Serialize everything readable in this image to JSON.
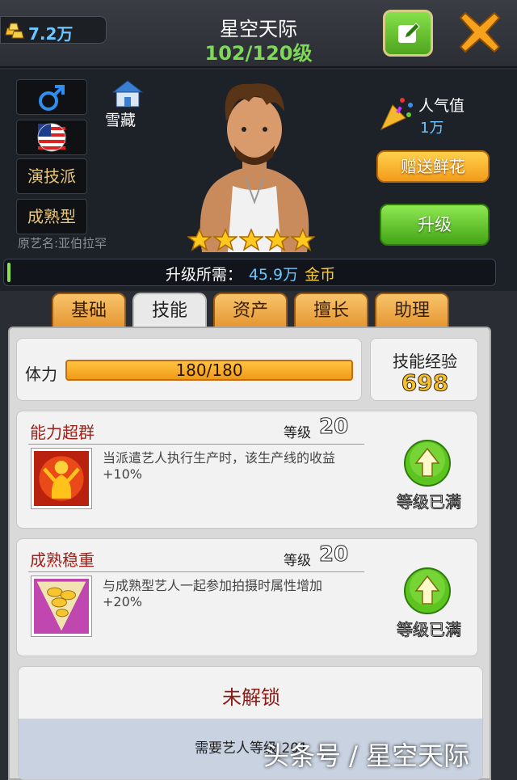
{
  "header": {
    "coins": "7.2万",
    "title": "星空天际",
    "level": "102/120级"
  },
  "profile": {
    "gender_icon": "male-icon",
    "region_icon": "us-flag-icon",
    "style_tag": "演技派",
    "type_tag": "成熟型",
    "original_name": "原艺名:亚伯拉罕",
    "label_name": "雪藏",
    "star_count": 5,
    "popularity_label": "人气值",
    "popularity_value": "1万",
    "gift_button": "赠送鲜花",
    "upgrade_button": "升级",
    "upgrade_req_label": "升级所需：",
    "upgrade_req_value": "45.9万",
    "upgrade_req_unit": "金币"
  },
  "tabs": [
    {
      "label": "基础",
      "active": false
    },
    {
      "label": "技能",
      "active": true
    },
    {
      "label": "资产",
      "active": false
    },
    {
      "label": "擅长",
      "active": false
    },
    {
      "label": "助理",
      "active": false
    }
  ],
  "stats": {
    "stamina_label": "体力",
    "stamina_value": "180/180",
    "stamina_fraction": 1.0,
    "skill_exp_label": "技能经验",
    "skill_exp_value": "698"
  },
  "skills": [
    {
      "name": "能力超群",
      "level_label": "等级",
      "level": "20",
      "description": "当派遣艺人执行生产时，该生产线的收益+10%",
      "status": "等级已满"
    },
    {
      "name": "成熟稳重",
      "level_label": "等级",
      "level": "20",
      "description": "与成熟型艺人一起参加拍摄时属性增加+20%",
      "status": "等级已满"
    }
  ],
  "locked_skill": {
    "title": "未解锁",
    "requirement": "需要艺人等级 201"
  },
  "watermark": "头条号 / 星空天际",
  "colors": {
    "accent_green": "#7ed957",
    "accent_blue": "#6ec6ff",
    "tab_orange": "#f0aa45",
    "skill_name_red": "#a0211a"
  }
}
